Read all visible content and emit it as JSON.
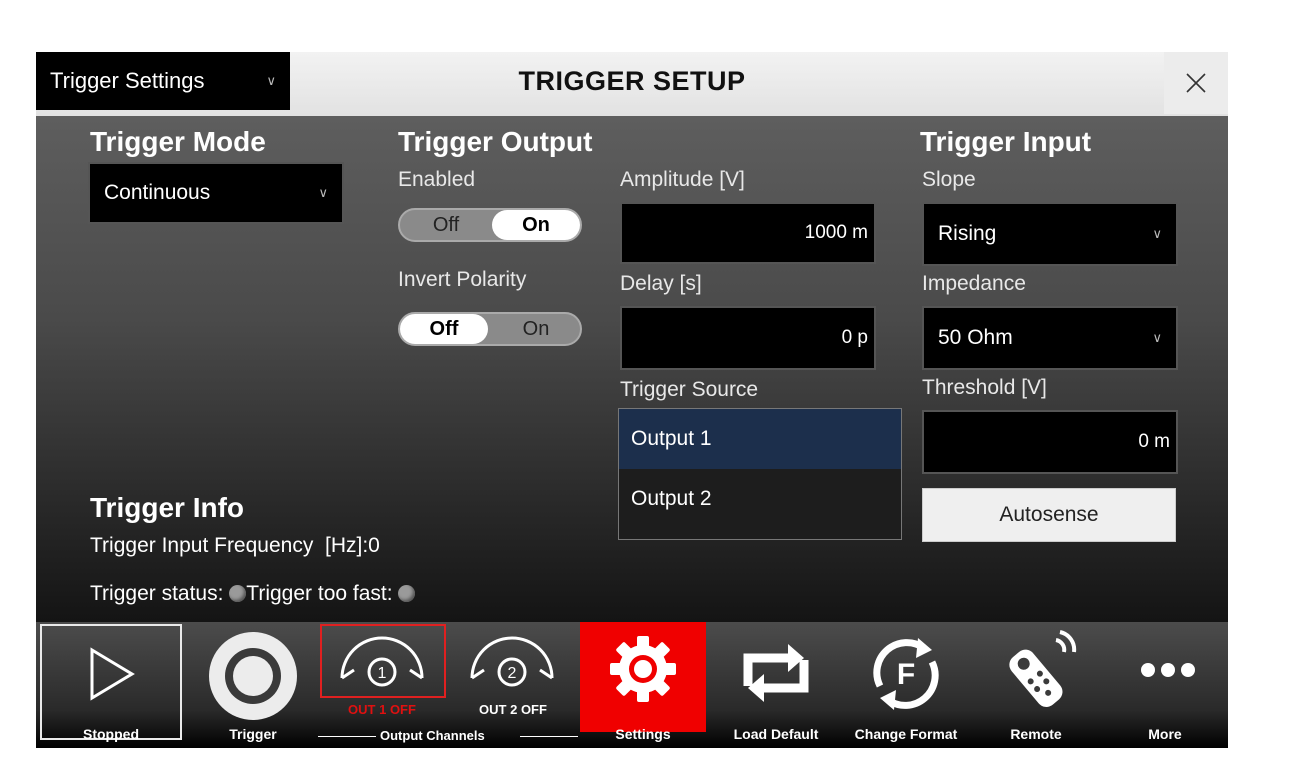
{
  "window": {
    "selector_value": "Trigger Settings",
    "title": "TRIGGER SETUP"
  },
  "trigger_mode": {
    "heading": "Trigger Mode",
    "value": "Continuous"
  },
  "trigger_output": {
    "heading": "Trigger Output",
    "enabled_label": "Enabled",
    "enabled_off": "Off",
    "enabled_on": "On",
    "enabled_state": "On",
    "invert_label": "Invert Polarity",
    "invert_off": "Off",
    "invert_on": "On",
    "invert_state": "Off",
    "amplitude_label": "Amplitude [V]",
    "amplitude_value": "1000 m",
    "delay_label": "Delay [s]",
    "delay_value": "0 p",
    "source_label": "Trigger Source",
    "source_options": [
      "Output 1",
      "Output 2"
    ],
    "source_selected": "Output 1"
  },
  "trigger_input": {
    "heading": "Trigger Input",
    "slope_label": "Slope",
    "slope_value": "Rising",
    "impedance_label": "Impedance",
    "impedance_value": "50 Ohm",
    "threshold_label": "Threshold [V]",
    "threshold_value": "0 m",
    "autosense_label": "Autosense"
  },
  "trigger_info": {
    "heading": "Trigger Info",
    "frequency_text": "Trigger Input Frequency  [Hz]:0",
    "status_label": "Trigger status:",
    "too_fast_label": "Trigger too fast:"
  },
  "toolbar": {
    "stopped": "Stopped",
    "trigger": "Trigger",
    "out1_num": "1",
    "out1_status": "OUT 1 OFF",
    "out2_num": "2",
    "out2_status": "OUT 2 OFF",
    "output_channels": "Output Channels",
    "settings": "Settings",
    "load_default": "Load Default",
    "change_format": "Change Format",
    "remote": "Remote",
    "more": "More"
  },
  "colors": {
    "settings_active": "#f00000",
    "out1_off_text": "#e01010",
    "selected_item": "#1c2f4c"
  }
}
